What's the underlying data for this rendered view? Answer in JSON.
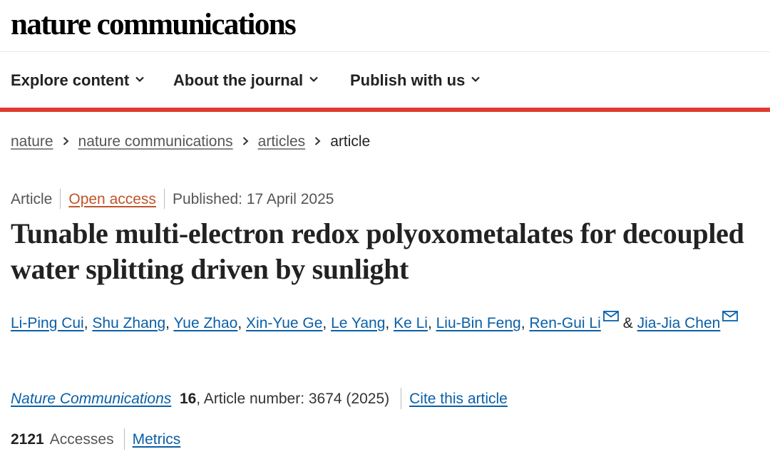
{
  "header": {
    "logo": "nature communications"
  },
  "nav": {
    "items": [
      {
        "label": "Explore content"
      },
      {
        "label": "About the journal"
      },
      {
        "label": "Publish with us"
      }
    ]
  },
  "breadcrumb": {
    "items": [
      "nature",
      "nature communications",
      "articles"
    ],
    "current": "article"
  },
  "meta": {
    "type": "Article",
    "access": "Open access",
    "published": "Published: 17 April 2025"
  },
  "article": {
    "title": "Tunable multi-electron redox polyoxometalates for decoupled water splitting driven by sunlight"
  },
  "authors": [
    {
      "name": "Li-Ping Cui",
      "sep": ", "
    },
    {
      "name": "Shu Zhang",
      "sep": ", "
    },
    {
      "name": "Yue Zhao",
      "sep": ", "
    },
    {
      "name": "Xin-Yue Ge",
      "sep": ", "
    },
    {
      "name": "Le Yang",
      "sep": ", "
    },
    {
      "name": "Ke Li",
      "sep": ", "
    },
    {
      "name": "Liu-Bin Feng",
      "sep": ", "
    },
    {
      "name": "Ren-Gui Li",
      "sep": ""
    },
    {
      "name": "Jia-Jia Chen",
      "sep": ""
    }
  ],
  "authors_conjunction": "&",
  "citation": {
    "journal": "Nature Communications",
    "volume": "16",
    "rest": ", Article number: 3674 (2025)",
    "cite_label": "Cite this article"
  },
  "metrics": {
    "accesses_count": "2121",
    "accesses_label": "Accesses",
    "metrics_label": "Metrics"
  },
  "colors": {
    "accent_rule": "#e03a2e",
    "link": "#0a5fa7",
    "open_access": "#c0542b"
  }
}
